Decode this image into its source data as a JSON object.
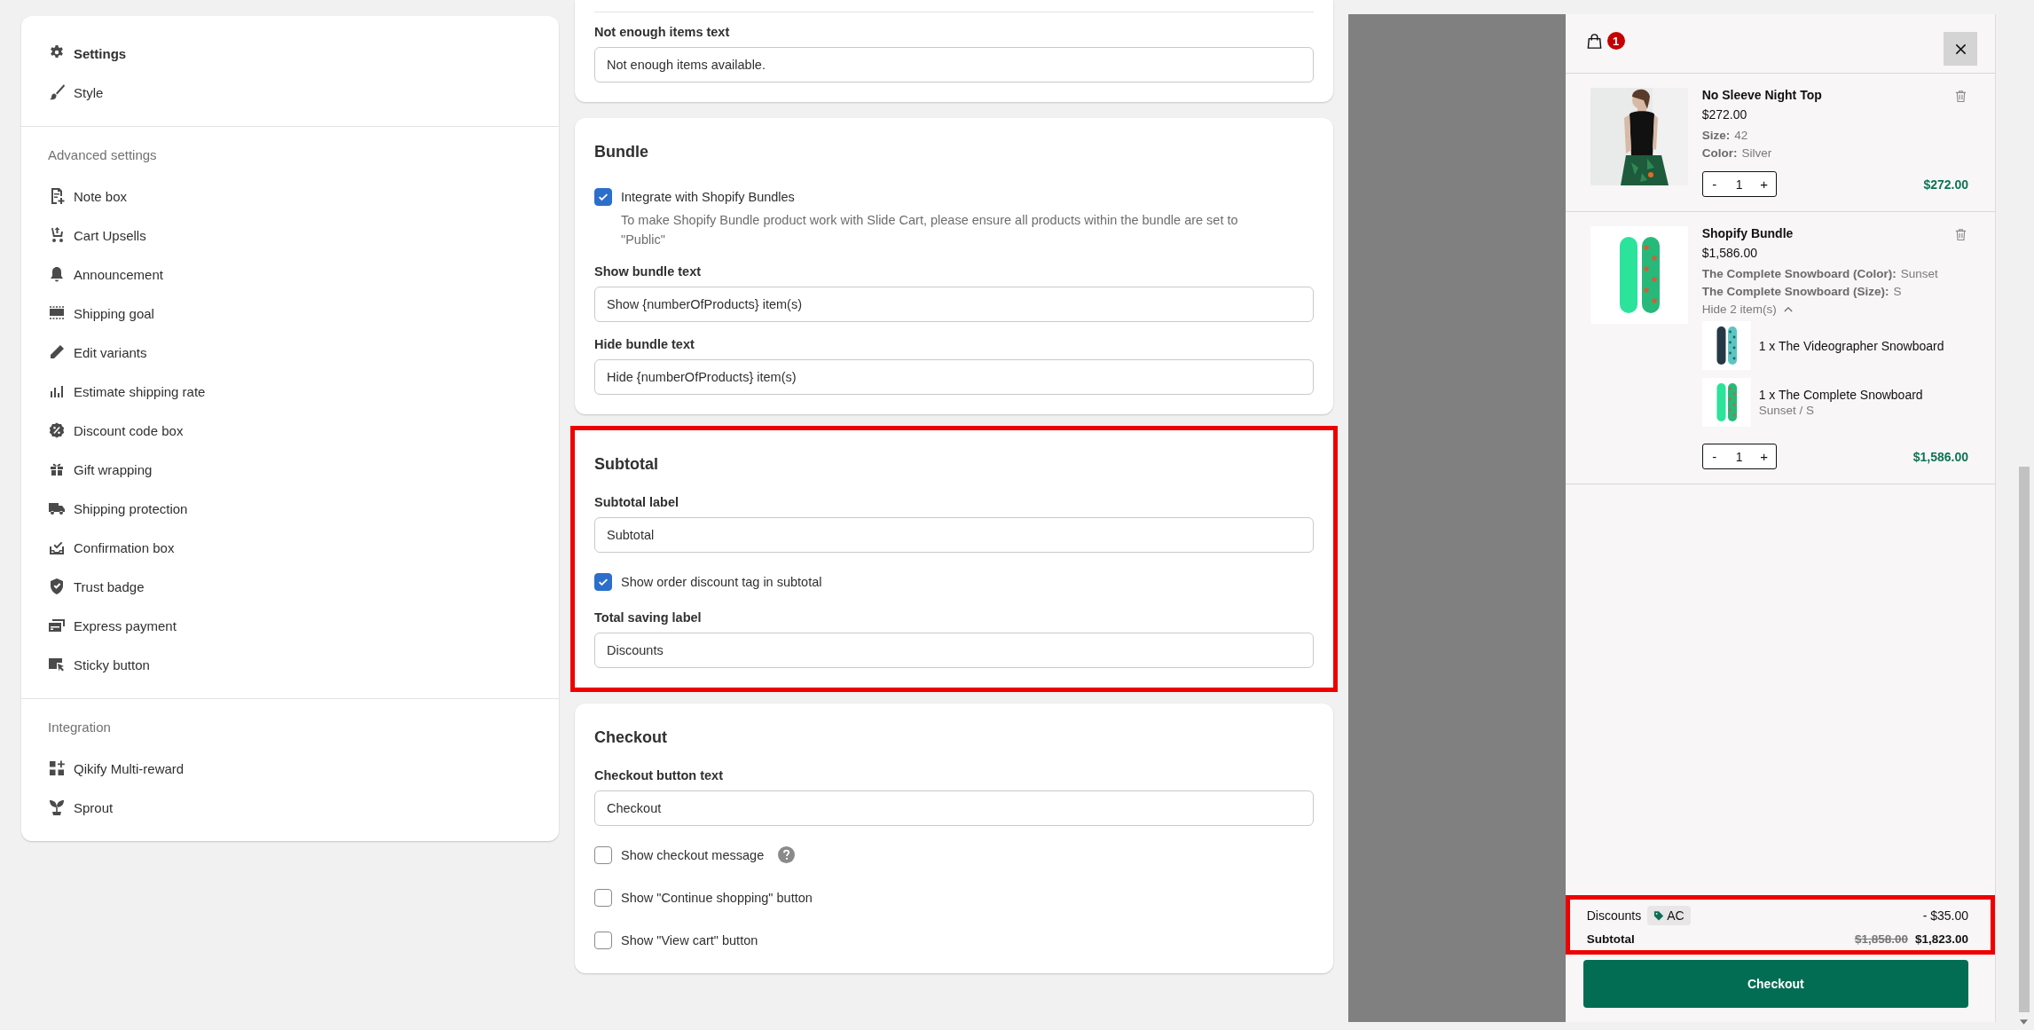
{
  "sidebar": {
    "sections": [
      {
        "items": [
          {
            "label": "Settings",
            "selected": true
          },
          {
            "label": "Style",
            "selected": false
          }
        ]
      },
      {
        "title": "Advanced settings",
        "items": [
          {
            "label": "Note box",
            "selected": false
          },
          {
            "label": "Cart Upsells",
            "selected": false
          },
          {
            "label": "Announcement",
            "selected": false
          },
          {
            "label": "Shipping goal",
            "selected": false
          },
          {
            "label": "Edit variants",
            "selected": false
          },
          {
            "label": "Estimate shipping rate",
            "selected": false
          },
          {
            "label": "Discount code box",
            "selected": false
          },
          {
            "label": "Gift wrapping",
            "selected": false
          },
          {
            "label": "Shipping protection",
            "selected": false
          },
          {
            "label": "Confirmation box",
            "selected": false
          },
          {
            "label": "Trust badge",
            "selected": false
          },
          {
            "label": "Express payment",
            "selected": false
          },
          {
            "label": "Sticky button",
            "selected": false
          }
        ]
      },
      {
        "title": "Integration",
        "items": [
          {
            "label": "Qikify Multi-reward",
            "selected": false
          },
          {
            "label": "Sprout",
            "selected": false
          }
        ]
      }
    ]
  },
  "cards": [
    {
      "highlighted": false,
      "fields": [
        {
          "kind": "text",
          "label": "Not enough items text",
          "value": "Not enough items available."
        }
      ]
    },
    {
      "title": "Bundle",
      "highlighted": false,
      "fields": [
        {
          "kind": "checkbox",
          "label": "Integrate with Shopify Bundles",
          "checked": true,
          "help_icon": false,
          "help": "To make Shopify Bundle product work with Slide Cart, please ensure all products within the bundle are set to \"Public\""
        },
        {
          "kind": "text",
          "label": "Show bundle text",
          "value": "Show {numberOfProducts} item(s)"
        },
        {
          "kind": "text",
          "label": "Hide bundle text",
          "value": "Hide {numberOfProducts} item(s)"
        }
      ]
    },
    {
      "title": "Subtotal",
      "highlighted": true,
      "fields": [
        {
          "kind": "text",
          "label": "Subtotal label",
          "value": "Subtotal"
        },
        {
          "kind": "checkbox",
          "label": "Show order discount tag in subtotal",
          "checked": true,
          "help_icon": false
        },
        {
          "kind": "text",
          "label": "Total saving label",
          "value": "Discounts"
        }
      ]
    },
    {
      "title": "Checkout",
      "highlighted": false,
      "fields": [
        {
          "kind": "text",
          "label": "Checkout button text",
          "value": "Checkout"
        },
        {
          "kind": "checkbox",
          "label": "Show checkout message",
          "checked": false,
          "help_icon": true
        },
        {
          "kind": "checkbox",
          "label": "Show \"Continue shopping\" button",
          "checked": false,
          "help_icon": false
        },
        {
          "kind": "checkbox",
          "label": "Show \"View cart\" button",
          "checked": false,
          "help_icon": false
        }
      ]
    }
  ],
  "cart": {
    "badge": "1",
    "items": [
      {
        "title": "No Sleeve Night Top",
        "price": "$272.00",
        "options": [
          {
            "name": "Size:",
            "value": "42"
          },
          {
            "name": "Color:",
            "value": "Silver"
          }
        ],
        "stepper": {
          "minus": "-",
          "quantity": "1",
          "plus": "+"
        },
        "total": "$272.00"
      },
      {
        "title": "Shopify Bundle",
        "price": "$1,586.00",
        "options": [
          {
            "name": "The Complete Snowboard (Color):",
            "value": "Sunset"
          },
          {
            "name": "The Complete Snowboard (Size):",
            "value": "S"
          }
        ],
        "bundle": {
          "toggle": "Hide 2 item(s)",
          "expanded": true,
          "children": [
            {
              "label": "1 x The Videographer Snowboard"
            },
            {
              "label": "1 x The Complete Snowboard",
              "variant": "Sunset / S"
            }
          ]
        },
        "stepper": {
          "minus": "-",
          "quantity": "1",
          "plus": "+"
        },
        "total": "$1,586.00"
      }
    ],
    "summary": {
      "highlighted": true,
      "discount_label": "Discounts",
      "discount_code": "AC",
      "discount_amount": "- $35.00",
      "subtotal_label": "Subtotal",
      "compare_price": "$1,858.00",
      "subtotal": "$1,823.00"
    },
    "checkout_button": "Checkout"
  }
}
